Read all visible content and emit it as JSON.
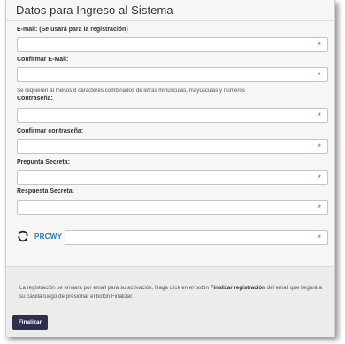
{
  "form": {
    "title": "Datos para Ingreso al Sistema",
    "fields": [
      {
        "label": "E-mail: (Se usará para la registración)",
        "value": ""
      },
      {
        "label": "Confirmar E-Mail:",
        "value": ""
      },
      {
        "label": "Contraseña:",
        "value": ""
      },
      {
        "label": "Confirmar contraseña:",
        "value": ""
      },
      {
        "label": "Pregunta Secreta:",
        "value": ""
      },
      {
        "label": "Respuesta Secreta:",
        "value": ""
      }
    ],
    "password_hint": "Se requieren al menos 8 caracteres combinados de letras minúsculas, mayúsculas y números",
    "required_mark": "*"
  },
  "captcha": {
    "icon": "refresh-icon",
    "code": "PRCWY",
    "value": ""
  },
  "footer": {
    "notice_before": "La registración se enviará por email para su activación. Haga click en el botón ",
    "notice_bold": "Finalizar registración",
    "notice_after": " del email que llegará a su casilla luego de presionar el botón Finalizar.",
    "submit_label": "Finalizar"
  },
  "colors": {
    "required": "#e23a3a",
    "captcha_text": "#2d7ab0",
    "button_bg": "#2d2f4d"
  }
}
